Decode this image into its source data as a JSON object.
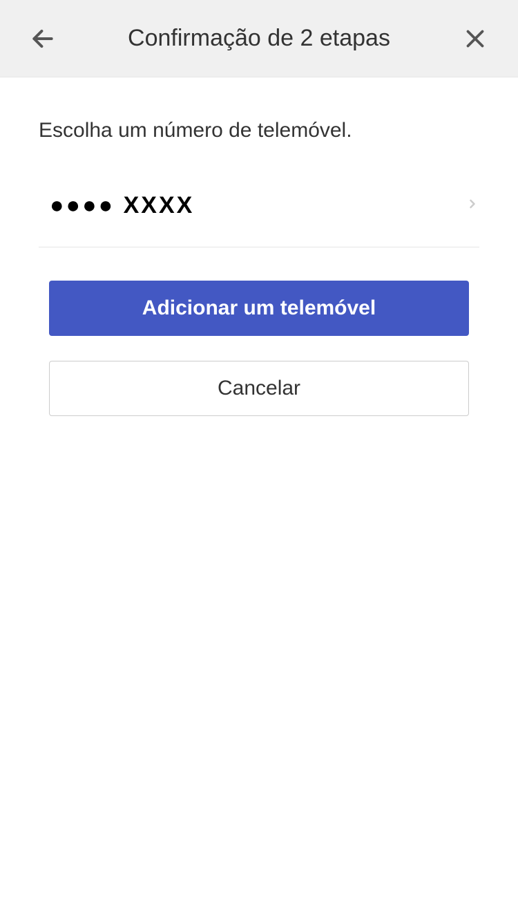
{
  "header": {
    "title": "Confirmação de 2 etapas"
  },
  "content": {
    "instruction": "Escolha um número de telemóvel.",
    "phone_masked": "●●●● XXXX",
    "add_phone_label": "Adicionar um telemóvel",
    "cancel_label": "Cancelar"
  }
}
